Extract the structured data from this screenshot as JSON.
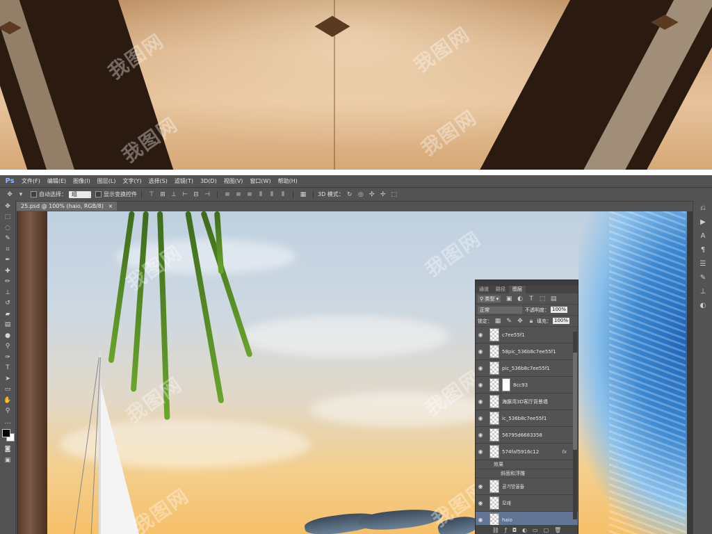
{
  "app": {
    "logo": "Ps",
    "menu": [
      "文件(F)",
      "编辑(E)",
      "图像(I)",
      "图层(L)",
      "文字(Y)",
      "选择(S)",
      "滤镜(T)",
      "3D(D)",
      "视图(V)",
      "窗口(W)",
      "帮助(H)"
    ]
  },
  "options_bar": {
    "auto_select_label": "自动选择：",
    "auto_select_value": "组",
    "show_transform_label": "显示变换控件",
    "mode_3d_label": "3D 模式："
  },
  "document": {
    "tab_title": "25.psd @ 100% (haio, RGB/8)",
    "close_glyph": "×"
  },
  "layers_panel": {
    "tabs": [
      "通道",
      "路径",
      "图层"
    ],
    "active_tab": 2,
    "filter_label": "类型",
    "blend_mode": "正常",
    "opacity_label": "不透明度：",
    "opacity_value": "100%",
    "lock_label": "锁定：",
    "fill_label": "填充：",
    "fill_value": "100%",
    "layers": [
      {
        "name": "c7ee55f1"
      },
      {
        "name": "58pic_536b8c7ee55f1"
      },
      {
        "name": "pic_536b8c7ee55f1"
      },
      {
        "name": "8cc93"
      },
      {
        "name": "海豚湾3D客厅背景墙"
      },
      {
        "name": "ic_536b8c7ee55f1"
      },
      {
        "name": "56795d6683358"
      },
      {
        "name": "574faf5916c12",
        "fx": "fx"
      },
      {
        "name": "공기방울들"
      },
      {
        "name": "모래"
      },
      {
        "name": "haio"
      }
    ],
    "effects_label": "效果",
    "effect_item": "斜面和浮雕"
  },
  "watermark_text": "我图网",
  "colors": {
    "ps_bg": "#535353",
    "selected_layer": "#637594",
    "ps_logo": "#8fb8ff"
  }
}
